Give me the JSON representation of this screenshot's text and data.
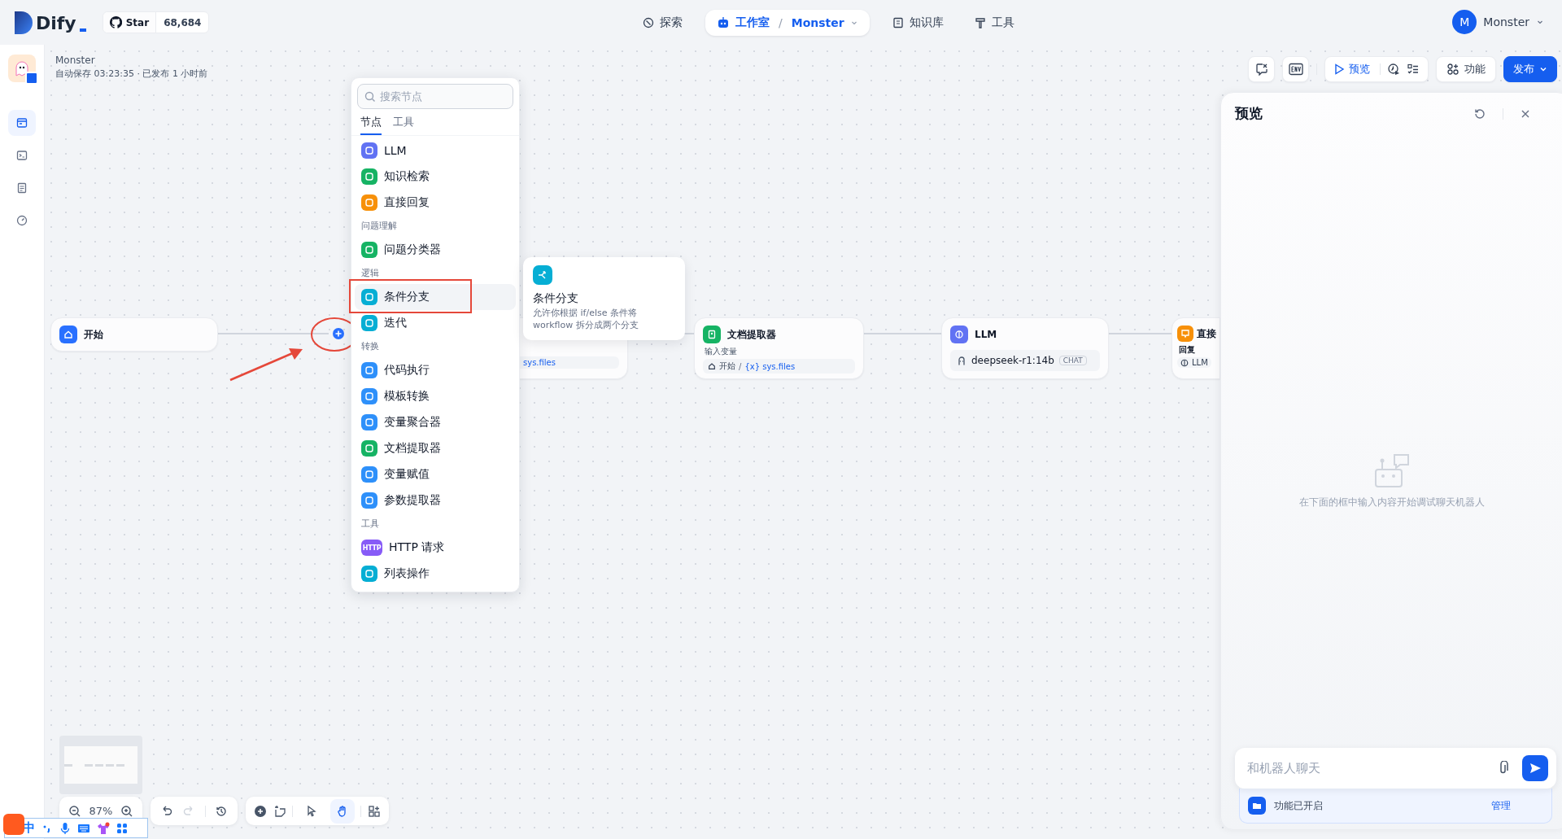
{
  "header": {
    "logo": "Dify",
    "github": {
      "label": "Star",
      "count": "68,684"
    },
    "nav": [
      {
        "label": "探索",
        "selected": false
      },
      {
        "label": "工作室",
        "selected": true,
        "separator": "/",
        "app": "Monster"
      },
      {
        "label": "知识库",
        "selected": false
      },
      {
        "label": "工具",
        "selected": false
      }
    ],
    "account": {
      "initial": "M",
      "name": "Monster"
    }
  },
  "sidebar": {
    "items": [
      {
        "selected": true
      },
      {
        "selected": false
      },
      {
        "selected": false
      },
      {
        "selected": false
      }
    ]
  },
  "app": {
    "name": "Monster",
    "status": "自动保存 03:23:35 · 已发布 1 小时前"
  },
  "toolbar": {
    "preview": "预览",
    "features": "功能",
    "publish": "发布"
  },
  "node_menu": {
    "search": {
      "placeholder": "搜索节点"
    },
    "tabs": [
      {
        "label": "节点",
        "selected": true
      },
      {
        "label": "工具",
        "selected": false
      }
    ],
    "entries": [
      {
        "kind": "node",
        "label": "LLM",
        "color": "#6172f3",
        "selected": false
      },
      {
        "kind": "node",
        "label": "知识检索",
        "color": "#16b364",
        "selected": false
      },
      {
        "kind": "node",
        "label": "直接回复",
        "color": "#f79009",
        "selected": false
      },
      {
        "kind": "heading",
        "label": "问题理解"
      },
      {
        "kind": "node",
        "label": "问题分类器",
        "color": "#16b364",
        "selected": false
      },
      {
        "kind": "heading",
        "label": "逻辑"
      },
      {
        "kind": "node",
        "label": "条件分支",
        "color": "#06aed4",
        "selected": true
      },
      {
        "kind": "node",
        "label": "迭代",
        "color": "#06aed4",
        "selected": false
      },
      {
        "kind": "heading",
        "label": "转换"
      },
      {
        "kind": "node",
        "label": "代码执行",
        "color": "#2e90fa",
        "selected": false
      },
      {
        "kind": "node",
        "label": "模板转换",
        "color": "#2e90fa",
        "selected": false
      },
      {
        "kind": "node",
        "label": "变量聚合器",
        "color": "#2e90fa",
        "selected": false
      },
      {
        "kind": "node",
        "label": "文档提取器",
        "color": "#16b364",
        "selected": false
      },
      {
        "kind": "node",
        "label": "变量赋值",
        "color": "#2e90fa",
        "selected": false
      },
      {
        "kind": "node",
        "label": "参数提取器",
        "color": "#2e90fa",
        "selected": false
      },
      {
        "kind": "heading",
        "label": "工具"
      },
      {
        "kind": "node",
        "label": "HTTP 请求",
        "color": "#875bf7",
        "icon_text": "HTTP",
        "selected": false
      },
      {
        "kind": "node",
        "label": "列表操作",
        "color": "#06aed4",
        "selected": false
      }
    ]
  },
  "tooltip": {
    "title": "条件分支",
    "description": "允许你根据 if/else 条件将 workflow 拆分成两个分支",
    "color": "#06aed4"
  },
  "nodes": [
    {
      "kind": "start",
      "title": "开始",
      "color": "#2970ff"
    },
    {
      "kind": "obscured",
      "variable": "sys.files"
    },
    {
      "kind": "extractor",
      "title": "文档提取器",
      "color": "#16b364",
      "label": "输入变量",
      "source": "开始",
      "separator": "/",
      "variable_mark": "{x}",
      "variable": "sys.files"
    },
    {
      "kind": "llm",
      "title": "LLM",
      "color": "#6172f3",
      "model": "deepseek-r1:14b",
      "badge": "CHAT"
    },
    {
      "kind": "answer",
      "title": "直接",
      "color": "#f79009",
      "label": "回复",
      "source": "LLM"
    }
  ],
  "canvas": {
    "zoom": "87%",
    "tools": [
      {
        "kind": "pointer",
        "selected": false
      },
      {
        "kind": "hand",
        "selected": true
      }
    ]
  },
  "preview": {
    "title": "预览",
    "empty_text": "在下面的框中输入内容开始调试聊天机器人",
    "input": {
      "placeholder": "和机器人聊天"
    },
    "features": {
      "label": "功能已开启",
      "link": "管理"
    }
  },
  "ime": {
    "mode": "中"
  }
}
